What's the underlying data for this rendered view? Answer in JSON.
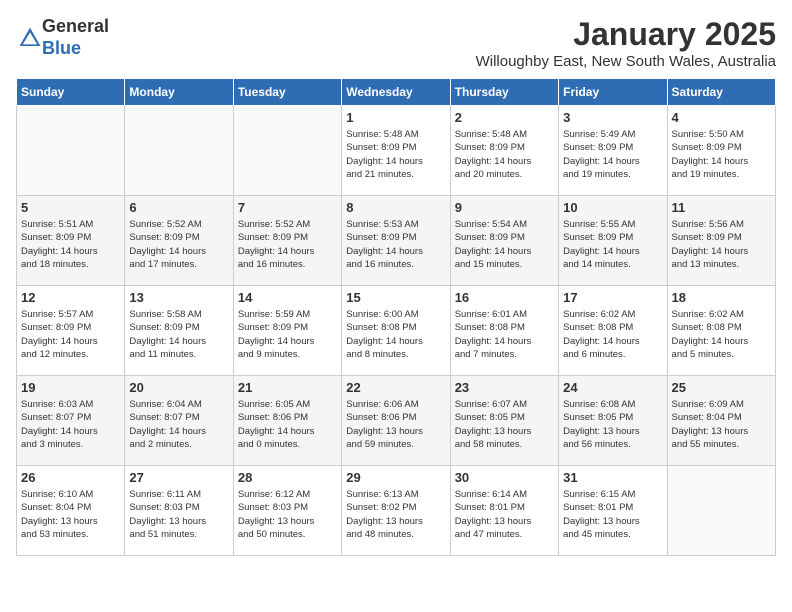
{
  "header": {
    "logo_general": "General",
    "logo_blue": "Blue",
    "month": "January 2025",
    "location": "Willoughby East, New South Wales, Australia"
  },
  "days_of_week": [
    "Sunday",
    "Monday",
    "Tuesday",
    "Wednesday",
    "Thursday",
    "Friday",
    "Saturday"
  ],
  "weeks": [
    [
      {
        "day": "",
        "info": ""
      },
      {
        "day": "",
        "info": ""
      },
      {
        "day": "",
        "info": ""
      },
      {
        "day": "1",
        "info": "Sunrise: 5:48 AM\nSunset: 8:09 PM\nDaylight: 14 hours\nand 21 minutes."
      },
      {
        "day": "2",
        "info": "Sunrise: 5:48 AM\nSunset: 8:09 PM\nDaylight: 14 hours\nand 20 minutes."
      },
      {
        "day": "3",
        "info": "Sunrise: 5:49 AM\nSunset: 8:09 PM\nDaylight: 14 hours\nand 19 minutes."
      },
      {
        "day": "4",
        "info": "Sunrise: 5:50 AM\nSunset: 8:09 PM\nDaylight: 14 hours\nand 19 minutes."
      }
    ],
    [
      {
        "day": "5",
        "info": "Sunrise: 5:51 AM\nSunset: 8:09 PM\nDaylight: 14 hours\nand 18 minutes."
      },
      {
        "day": "6",
        "info": "Sunrise: 5:52 AM\nSunset: 8:09 PM\nDaylight: 14 hours\nand 17 minutes."
      },
      {
        "day": "7",
        "info": "Sunrise: 5:52 AM\nSunset: 8:09 PM\nDaylight: 14 hours\nand 16 minutes."
      },
      {
        "day": "8",
        "info": "Sunrise: 5:53 AM\nSunset: 8:09 PM\nDaylight: 14 hours\nand 16 minutes."
      },
      {
        "day": "9",
        "info": "Sunrise: 5:54 AM\nSunset: 8:09 PM\nDaylight: 14 hours\nand 15 minutes."
      },
      {
        "day": "10",
        "info": "Sunrise: 5:55 AM\nSunset: 8:09 PM\nDaylight: 14 hours\nand 14 minutes."
      },
      {
        "day": "11",
        "info": "Sunrise: 5:56 AM\nSunset: 8:09 PM\nDaylight: 14 hours\nand 13 minutes."
      }
    ],
    [
      {
        "day": "12",
        "info": "Sunrise: 5:57 AM\nSunset: 8:09 PM\nDaylight: 14 hours\nand 12 minutes."
      },
      {
        "day": "13",
        "info": "Sunrise: 5:58 AM\nSunset: 8:09 PM\nDaylight: 14 hours\nand 11 minutes."
      },
      {
        "day": "14",
        "info": "Sunrise: 5:59 AM\nSunset: 8:09 PM\nDaylight: 14 hours\nand 9 minutes."
      },
      {
        "day": "15",
        "info": "Sunrise: 6:00 AM\nSunset: 8:08 PM\nDaylight: 14 hours\nand 8 minutes."
      },
      {
        "day": "16",
        "info": "Sunrise: 6:01 AM\nSunset: 8:08 PM\nDaylight: 14 hours\nand 7 minutes."
      },
      {
        "day": "17",
        "info": "Sunrise: 6:02 AM\nSunset: 8:08 PM\nDaylight: 14 hours\nand 6 minutes."
      },
      {
        "day": "18",
        "info": "Sunrise: 6:02 AM\nSunset: 8:08 PM\nDaylight: 14 hours\nand 5 minutes."
      }
    ],
    [
      {
        "day": "19",
        "info": "Sunrise: 6:03 AM\nSunset: 8:07 PM\nDaylight: 14 hours\nand 3 minutes."
      },
      {
        "day": "20",
        "info": "Sunrise: 6:04 AM\nSunset: 8:07 PM\nDaylight: 14 hours\nand 2 minutes."
      },
      {
        "day": "21",
        "info": "Sunrise: 6:05 AM\nSunset: 8:06 PM\nDaylight: 14 hours\nand 0 minutes."
      },
      {
        "day": "22",
        "info": "Sunrise: 6:06 AM\nSunset: 8:06 PM\nDaylight: 13 hours\nand 59 minutes."
      },
      {
        "day": "23",
        "info": "Sunrise: 6:07 AM\nSunset: 8:05 PM\nDaylight: 13 hours\nand 58 minutes."
      },
      {
        "day": "24",
        "info": "Sunrise: 6:08 AM\nSunset: 8:05 PM\nDaylight: 13 hours\nand 56 minutes."
      },
      {
        "day": "25",
        "info": "Sunrise: 6:09 AM\nSunset: 8:04 PM\nDaylight: 13 hours\nand 55 minutes."
      }
    ],
    [
      {
        "day": "26",
        "info": "Sunrise: 6:10 AM\nSunset: 8:04 PM\nDaylight: 13 hours\nand 53 minutes."
      },
      {
        "day": "27",
        "info": "Sunrise: 6:11 AM\nSunset: 8:03 PM\nDaylight: 13 hours\nand 51 minutes."
      },
      {
        "day": "28",
        "info": "Sunrise: 6:12 AM\nSunset: 8:03 PM\nDaylight: 13 hours\nand 50 minutes."
      },
      {
        "day": "29",
        "info": "Sunrise: 6:13 AM\nSunset: 8:02 PM\nDaylight: 13 hours\nand 48 minutes."
      },
      {
        "day": "30",
        "info": "Sunrise: 6:14 AM\nSunset: 8:01 PM\nDaylight: 13 hours\nand 47 minutes."
      },
      {
        "day": "31",
        "info": "Sunrise: 6:15 AM\nSunset: 8:01 PM\nDaylight: 13 hours\nand 45 minutes."
      },
      {
        "day": "",
        "info": ""
      }
    ]
  ]
}
